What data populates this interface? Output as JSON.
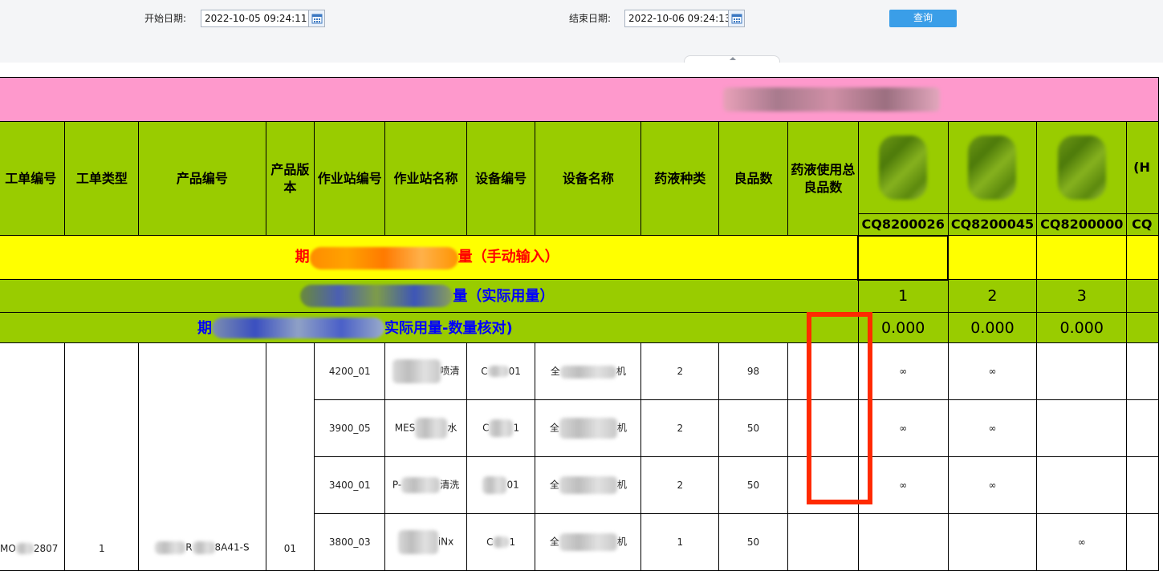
{
  "filter": {
    "start_label": "开始日期:",
    "start_value": "2022-10-05 09:24:11",
    "end_label": "结束日期:",
    "end_value": "2022-10-06 09:24:13",
    "query_label": "查询"
  },
  "report": {
    "headers": {
      "work_order_no": "工单编号",
      "work_order_type": "工单类型",
      "product_no": "产品编号",
      "product_version": "产品版本",
      "station_no": "作业站编号",
      "station_name": "作业站名称",
      "equipment_no": "设备编号",
      "equipment_name": "设备名称",
      "chemical_type": "药液种类",
      "good_qty": "良品数",
      "chemical_total_good": "药液使用总良品数"
    },
    "chemical_columns": [
      {
        "code": "CQ8200026",
        "label_visible": "(ACE) 子 桶/ 米方"
      },
      {
        "code": "CQ8200045",
        "label_visible": "异 PA) > 电 子级 桶/"
      },
      {
        "code": "CQ8200000",
        "label_visible": "1 子级 /"
      },
      {
        "code": "CQ",
        "label_visible": "(H 级 20"
      }
    ],
    "rows_label": {
      "manual_input": "量（手动输入）",
      "manual_input_prefix": "期",
      "actual_usage": "量（实际用量）",
      "actual_check": "实际用量-数量核对)",
      "actual_check_prefix": "期"
    },
    "actual_usage_values": [
      "1",
      "2",
      "3",
      ""
    ],
    "actual_check_values": [
      "0.000",
      "0.000",
      "0.000",
      ""
    ],
    "work_order": {
      "no_visible": "MO 2807",
      "type": "1",
      "product_visible": "R 8A41-S",
      "version": "01"
    },
    "data_rows": [
      {
        "station_no": "4200_01",
        "station_name_visible": "喷清 洗",
        "equip_no_visible": "C 01",
        "equip_name_visible": "全 机",
        "chem_type": "2",
        "good": "98",
        "c1": "∞",
        "c2": "∞",
        "c3": "",
        "c4": ""
      },
      {
        "station_no": "3900_05",
        "station_name_visible": "MES 水 甩干",
        "equip_no_visible": "C 1",
        "equip_name_visible": "全 机",
        "chem_type": "2",
        "good": "50",
        "c1": "∞",
        "c2": "∞",
        "c3": "",
        "c4": ""
      },
      {
        "station_no": "3400_01",
        "station_name_visible": "P- 清洗",
        "equip_no_visible": "01",
        "equip_name_visible": "全 机",
        "chem_type": "2",
        "good": "50",
        "c1": "∞",
        "c2": "∞",
        "c3": "",
        "c4": ""
      },
      {
        "station_no": "3800_03",
        "station_name_visible": "iNx 洗",
        "equip_no_visible": "C 1",
        "equip_name_visible": "全 机",
        "chem_type": "1",
        "good": "50",
        "c1": "",
        "c2": "",
        "c3": "∞",
        "c4": ""
      }
    ]
  },
  "colors": {
    "title_row": "#fe99cc",
    "header_green": "#99cc00",
    "input_yellow": "#ffff00",
    "highlight_red": "#ff2a00",
    "query_button": "#3a9ee8"
  },
  "icons": [
    "calendar-icon",
    "collapse-up-icon"
  ]
}
